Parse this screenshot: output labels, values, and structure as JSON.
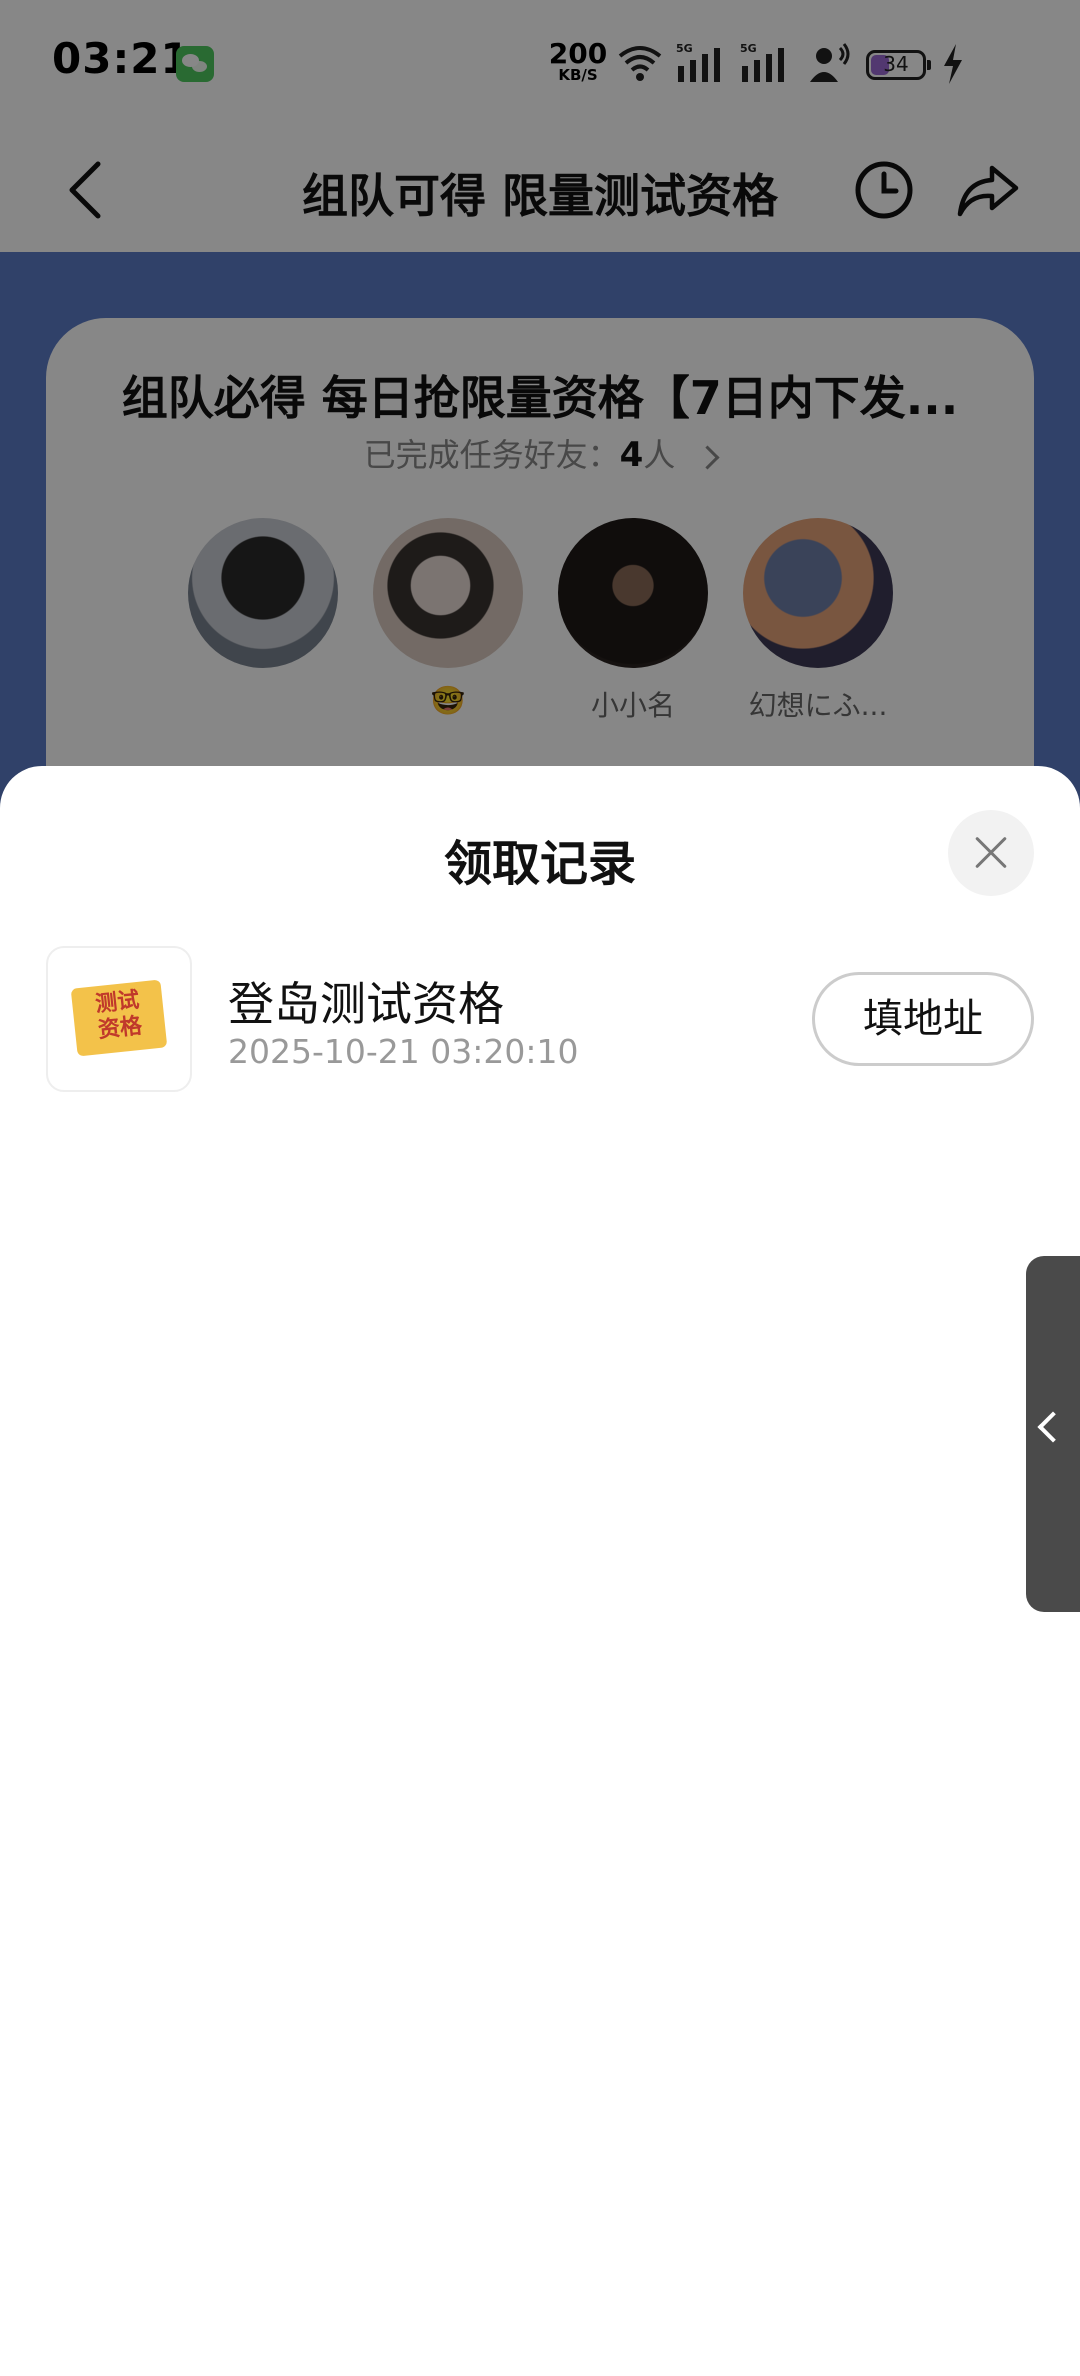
{
  "status_bar": {
    "time": "03:21",
    "net_speed_value": "200",
    "net_speed_unit": "KB/S",
    "signal_1": "5G",
    "signal_2": "5G",
    "battery_level": "34",
    "icons": [
      "wechat-icon",
      "wifi-icon",
      "signal-icon",
      "signal-icon",
      "hotspot-icon",
      "battery-icon",
      "charging-icon"
    ]
  },
  "nav": {
    "title": "组队可得 限量测试资格",
    "icons": [
      "back-icon",
      "history-icon",
      "share-icon"
    ]
  },
  "task_card": {
    "title": "组队必得 每日抢限量资格【7日内下发...",
    "subtitle_prefix": "已完成任务好友：",
    "friend_count": "4",
    "subtitle_suffix": "人",
    "friends": [
      {
        "name": ""
      },
      {
        "name": "🤓"
      },
      {
        "name": "小小名"
      },
      {
        "name": "幻想にふ..."
      }
    ]
  },
  "sheet": {
    "title": "领取记录",
    "records": [
      {
        "thumb_text": "测试资格",
        "name": "登岛测试资格",
        "time": "2025-10-21 03:20:10",
        "action_label": "填地址"
      }
    ]
  },
  "colors": {
    "hero_bg": "#5c7cc7",
    "overlay": "rgba(0,0,0,0.47)",
    "wechat": "#4fc85f",
    "battery": "#9b6bd4",
    "ticket": "#f3c24a",
    "ticket_text": "#c0392b"
  }
}
